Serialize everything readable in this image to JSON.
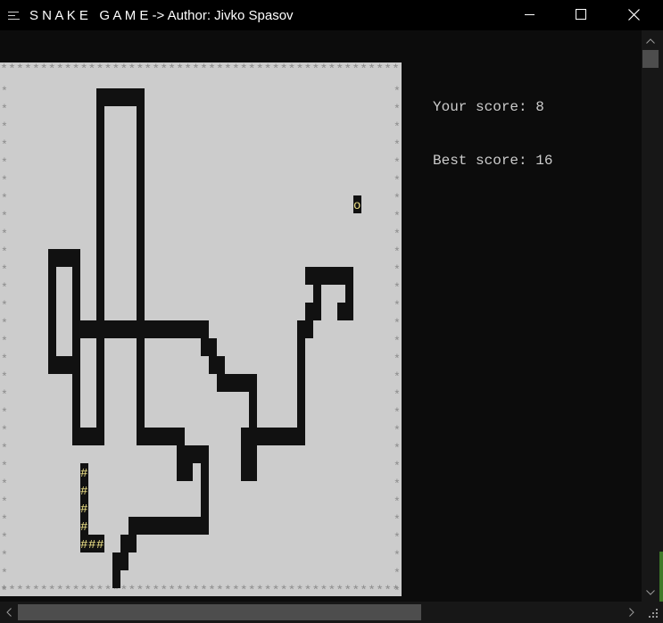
{
  "window": {
    "title": "S N A K E   G A M E -> Author: Jivko Spasov",
    "app_icon": "console-icon",
    "minimize_icon": "minimize-icon",
    "maximize_icon": "maximize-icon",
    "close_icon": "close-icon"
  },
  "colors": {
    "board_bg": "#cccccc",
    "board_border": "#8a8a8a",
    "console_bg": "#0c0c0c",
    "obstacle": "#111111",
    "snake_head": "#f2e58a",
    "food": "#f2e58a",
    "score_text": "#cccccc"
  },
  "scores": {
    "your_score": "Your score: 8",
    "best_score": "Best score: 16"
  },
  "board": {
    "cols": 50,
    "rows": 30,
    "border_char": "*",
    "snake_char": "#",
    "food_char": "o",
    "food": {
      "row": 7,
      "col": 44
    },
    "snake": [
      {
        "row": 22,
        "col": 10
      },
      {
        "row": 23,
        "col": 10
      },
      {
        "row": 24,
        "col": 10
      },
      {
        "row": 25,
        "col": 10
      },
      {
        "row": 26,
        "col": 10
      },
      {
        "row": 26,
        "col": 11
      },
      {
        "row": 26,
        "col": 12
      }
    ],
    "obstacles": [
      [
        1,
        12
      ],
      [
        1,
        13
      ],
      [
        1,
        14
      ],
      [
        1,
        15
      ],
      [
        1,
        16
      ],
      [
        1,
        17
      ],
      [
        2,
        12
      ],
      [
        2,
        17
      ],
      [
        3,
        12
      ],
      [
        3,
        17
      ],
      [
        4,
        12
      ],
      [
        4,
        17
      ],
      [
        5,
        12
      ],
      [
        5,
        17
      ],
      [
        6,
        12
      ],
      [
        6,
        17
      ],
      [
        7,
        12
      ],
      [
        7,
        17
      ],
      [
        8,
        12
      ],
      [
        8,
        17
      ],
      [
        9,
        12
      ],
      [
        9,
        17
      ],
      [
        10,
        6
      ],
      [
        10,
        7
      ],
      [
        10,
        8
      ],
      [
        10,
        9
      ],
      [
        10,
        12
      ],
      [
        10,
        17
      ],
      [
        11,
        6
      ],
      [
        11,
        9
      ],
      [
        11,
        12
      ],
      [
        11,
        17
      ],
      [
        11,
        38
      ],
      [
        11,
        39
      ],
      [
        11,
        40
      ],
      [
        11,
        41
      ],
      [
        11,
        42
      ],
      [
        11,
        43
      ],
      [
        12,
        6
      ],
      [
        12,
        9
      ],
      [
        12,
        12
      ],
      [
        12,
        17
      ],
      [
        12,
        39
      ],
      [
        12,
        43
      ],
      [
        13,
        6
      ],
      [
        13,
        9
      ],
      [
        13,
        12
      ],
      [
        13,
        17
      ],
      [
        13,
        38
      ],
      [
        13,
        39
      ],
      [
        13,
        42
      ],
      [
        13,
        43
      ],
      [
        14,
        6
      ],
      [
        14,
        9
      ],
      [
        14,
        10
      ],
      [
        14,
        11
      ],
      [
        14,
        12
      ],
      [
        14,
        13
      ],
      [
        14,
        14
      ],
      [
        14,
        15
      ],
      [
        14,
        16
      ],
      [
        14,
        17
      ],
      [
        14,
        18
      ],
      [
        14,
        19
      ],
      [
        14,
        20
      ],
      [
        14,
        21
      ],
      [
        14,
        22
      ],
      [
        14,
        23
      ],
      [
        14,
        24
      ],
      [
        14,
        25
      ],
      [
        14,
        37
      ],
      [
        14,
        38
      ],
      [
        15,
        6
      ],
      [
        15,
        9
      ],
      [
        15,
        12
      ],
      [
        15,
        17
      ],
      [
        15,
        25
      ],
      [
        15,
        26
      ],
      [
        15,
        37
      ],
      [
        16,
        6
      ],
      [
        16,
        7
      ],
      [
        16,
        8
      ],
      [
        16,
        9
      ],
      [
        16,
        12
      ],
      [
        16,
        17
      ],
      [
        16,
        26
      ],
      [
        16,
        27
      ],
      [
        16,
        37
      ],
      [
        17,
        9
      ],
      [
        17,
        12
      ],
      [
        17,
        17
      ],
      [
        17,
        27
      ],
      [
        17,
        28
      ],
      [
        17,
        29
      ],
      [
        17,
        30
      ],
      [
        17,
        31
      ],
      [
        17,
        37
      ],
      [
        18,
        9
      ],
      [
        18,
        12
      ],
      [
        18,
        17
      ],
      [
        18,
        31
      ],
      [
        18,
        37
      ],
      [
        19,
        9
      ],
      [
        19,
        12
      ],
      [
        19,
        17
      ],
      [
        19,
        31
      ],
      [
        19,
        37
      ],
      [
        20,
        9
      ],
      [
        20,
        10
      ],
      [
        20,
        11
      ],
      [
        20,
        12
      ],
      [
        20,
        17
      ],
      [
        20,
        18
      ],
      [
        20,
        19
      ],
      [
        20,
        20
      ],
      [
        20,
        21
      ],
      [
        20,
        22
      ],
      [
        20,
        30
      ],
      [
        20,
        31
      ],
      [
        20,
        32
      ],
      [
        20,
        33
      ],
      [
        20,
        34
      ],
      [
        20,
        35
      ],
      [
        20,
        36
      ],
      [
        20,
        37
      ],
      [
        21,
        22
      ],
      [
        21,
        23
      ],
      [
        21,
        24
      ],
      [
        21,
        25
      ],
      [
        21,
        30
      ],
      [
        21,
        31
      ],
      [
        22,
        22
      ],
      [
        22,
        23
      ],
      [
        22,
        25
      ],
      [
        22,
        30
      ],
      [
        22,
        31
      ],
      [
        23,
        25
      ],
      [
        24,
        25
      ],
      [
        25,
        16
      ],
      [
        25,
        17
      ],
      [
        25,
        18
      ],
      [
        25,
        19
      ],
      [
        25,
        20
      ],
      [
        25,
        21
      ],
      [
        25,
        22
      ],
      [
        25,
        23
      ],
      [
        25,
        24
      ],
      [
        25,
        25
      ],
      [
        26,
        15
      ],
      [
        26,
        16
      ],
      [
        27,
        14
      ],
      [
        27,
        15
      ],
      [
        28,
        14
      ]
    ]
  }
}
